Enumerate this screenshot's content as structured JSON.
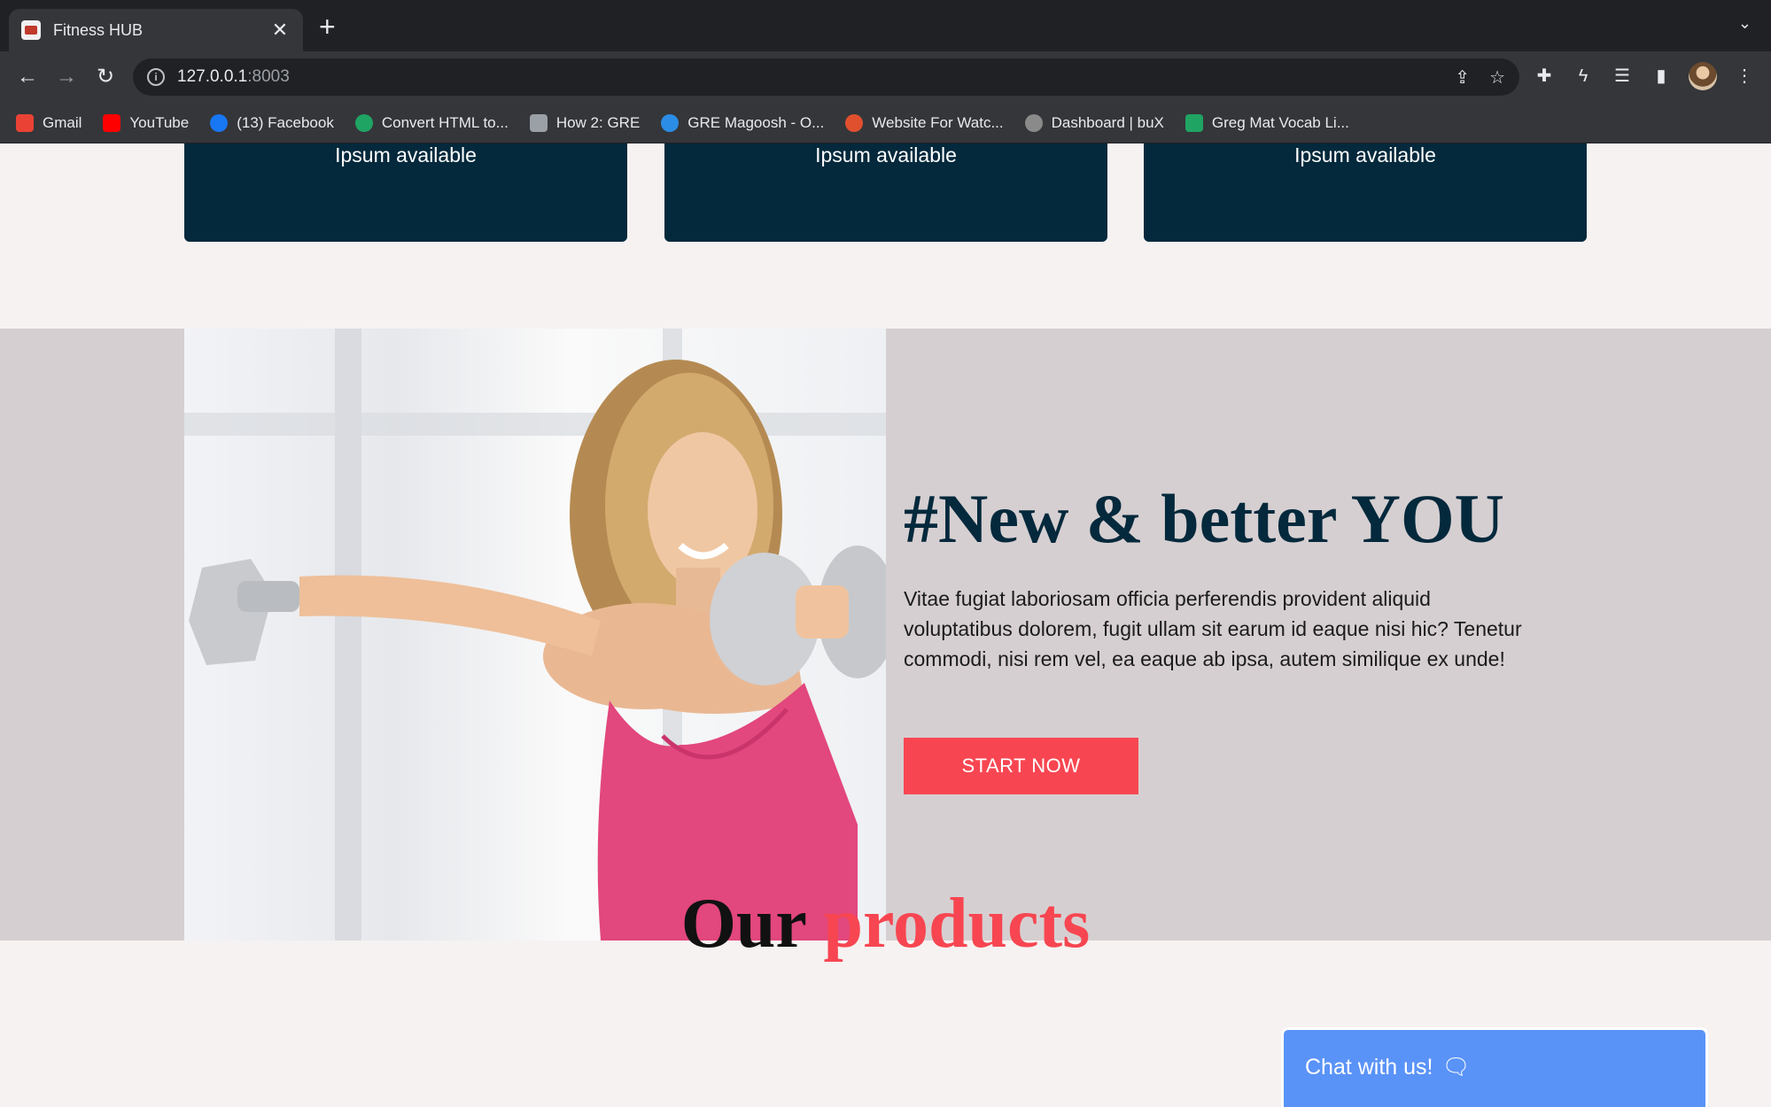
{
  "browser": {
    "tab_title": "Fitness HUB",
    "tab_close": "✕",
    "new_tab": "+",
    "url_host": "127.0.0.1",
    "url_port": ":8003",
    "bookmarks": [
      {
        "label": "Gmail",
        "color": "#ea4335"
      },
      {
        "label": "YouTube",
        "color": "#ff0000"
      },
      {
        "label": "(13) Facebook",
        "color": "#1877f2"
      },
      {
        "label": "Convert HTML to...",
        "color": "#1fa463"
      },
      {
        "label": "How 2: GRE",
        "color": "#9aa0a6"
      },
      {
        "label": "GRE Magoosh - O...",
        "color": "#2b8de6"
      },
      {
        "label": "Website For Watc...",
        "color": "#e0502f"
      },
      {
        "label": "Dashboard | buX",
        "color": "#8a8a8a"
      },
      {
        "label": "Greg Mat Vocab Li...",
        "color": "#1fa463"
      }
    ]
  },
  "feature_cards": [
    {
      "text": "Ipsum available"
    },
    {
      "text": "Ipsum available"
    },
    {
      "text": "Ipsum available"
    }
  ],
  "promo": {
    "heading": "#New & better YOU",
    "body": "Vitae fugiat laboriosam officia perferendis provident aliquid voluptatibus dolorem, fugit ullam sit earum id eaque nisi hic? Tenetur commodi, nisi rem vel, ea eaque ab ipsa, autem similique ex unde!",
    "cta_label": "START NOW"
  },
  "products": {
    "title_plain": "Our ",
    "title_accent": "products"
  },
  "chat": {
    "label": "Chat with us!",
    "icon": "🗨"
  },
  "colors": {
    "navy": "#04293c",
    "accent": "#f74651",
    "promo_bg": "#d6cfd1",
    "page_bg": "#f6f2f1",
    "chat_bg": "#5a93f7"
  }
}
